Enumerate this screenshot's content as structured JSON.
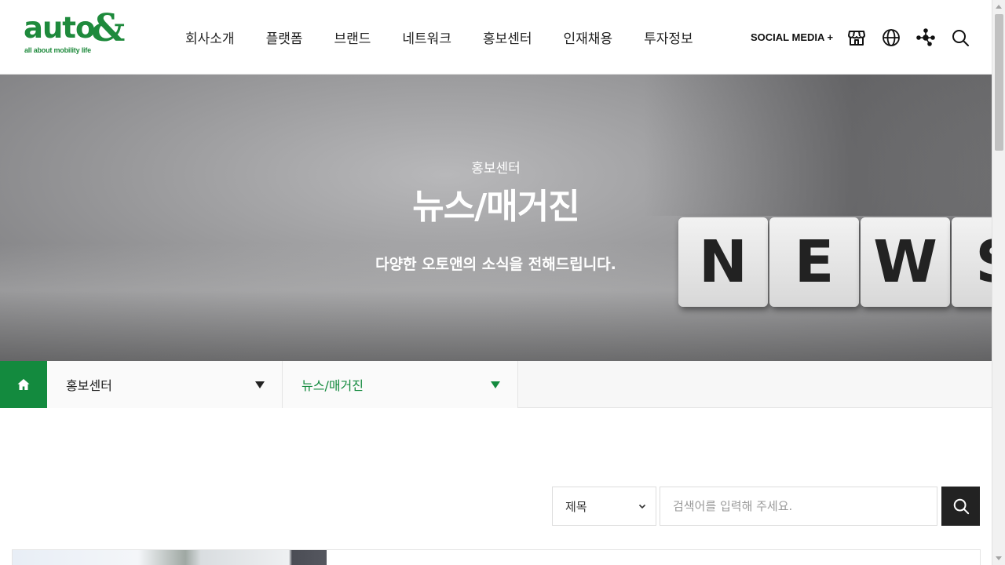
{
  "header": {
    "logo_word": "auto",
    "logo_amp": "&",
    "logo_tagline": "all about mobility life",
    "nav": [
      "회사소개",
      "플랫폼",
      "브랜드",
      "네트워크",
      "홍보센터",
      "인재채용",
      "투자정보"
    ],
    "social_label": "SOCIAL MEDIA +",
    "icons": [
      "store-icon",
      "globe-icon",
      "sitemap-icon",
      "search-icon"
    ]
  },
  "hero": {
    "subtitle": "홍보센터",
    "title": "뉴스/매거진",
    "description": "다양한 오토앤의 소식을 전해드립니다.",
    "tiles": [
      "N",
      "E",
      "W",
      "S"
    ]
  },
  "location": {
    "home_icon": "home-icon",
    "depth1": "홍보센터",
    "depth2": "뉴스/매거진"
  },
  "search": {
    "field_selected": "제목",
    "placeholder": "검색어를 입력해 주세요."
  },
  "colors": {
    "brand_green": "#1e8a3c",
    "location_green": "#138a3e",
    "search_button": "#222222"
  }
}
